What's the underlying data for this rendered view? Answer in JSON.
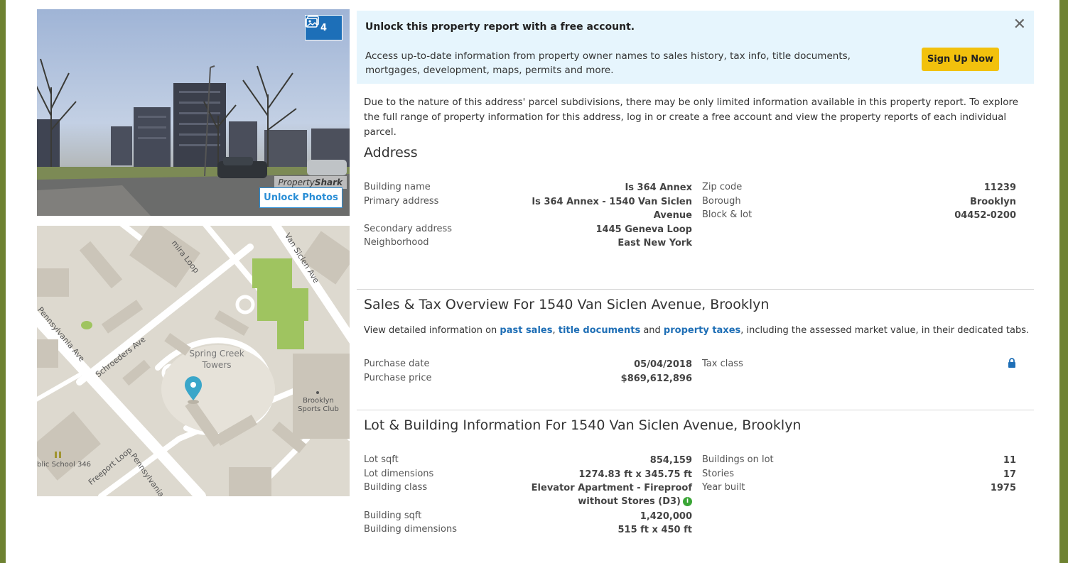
{
  "photo": {
    "count": "4",
    "watermark_a": "Property",
    "watermark_b": "Shark",
    "unlock_label": "Unlock Photos"
  },
  "map": {
    "labels": {
      "elmira_loop": "mira Loop",
      "van_siclen": "Van Siclen Ave",
      "pennsylvania_top": "Pennsylvania Ave",
      "schroeders": "Schroeders Ave",
      "freeport": "Freeport Loop",
      "pennsylvania_bottom": "Pennsylvania A",
      "public_school": "blic School 346"
    },
    "place_line1": "Spring Creek",
    "place_line2": "Towers",
    "club_line1": "Brooklyn",
    "club_line2": "Sports Club"
  },
  "banner": {
    "title": "Unlock this property report with a free account.",
    "text": "Access up-to-date information from property owner names to sales history, tax info, title documents, mortgages, development, maps, permits and more.",
    "signup_label": "Sign Up Now",
    "close_glyph": "✕"
  },
  "notice": "Due to the nature of this address' parcel subdivisions, there may be only limited information available in this property report. To explore the full range of property information for this address, log in or create a free account and view the property reports of each individual parcel.",
  "address": {
    "title": "Address",
    "building_name_label": "Building name",
    "building_name": "Is 364 Annex",
    "primary_address_label": "Primary address",
    "primary_address_line1": "Is 364 Annex - 1540 Van Siclen",
    "primary_address_line2": "Avenue",
    "secondary_address_label": "Secondary address",
    "secondary_address": "1445 Geneva Loop",
    "neighborhood_label": "Neighborhood",
    "neighborhood": "East New York",
    "zip_label": "Zip code",
    "zip": "11239",
    "borough_label": "Borough",
    "borough": "Brooklyn",
    "block_lot_label": "Block & lot",
    "block_lot": "04452-0200"
  },
  "sales": {
    "title": "Sales & Tax Overview For 1540 Van Siclen Avenue, Brooklyn",
    "desc_pre": "View detailed information on ",
    "link_sales": "past sales",
    "sep1": ", ",
    "link_title": "title documents",
    "sep2": " and ",
    "link_taxes": "property taxes",
    "desc_post": ", including the assessed market value, in their dedicated tabs.",
    "purchase_date_label": "Purchase date",
    "purchase_date": "05/04/2018",
    "purchase_price_label": "Purchase price",
    "purchase_price": "$869,612,896",
    "tax_class_label": "Tax class"
  },
  "lot": {
    "title": "Lot & Building Information For 1540 Van Siclen Avenue, Brooklyn",
    "lot_sqft_label": "Lot sqft",
    "lot_sqft": "854,159",
    "lot_dim_label": "Lot dimensions",
    "lot_dim": "1274.83 ft x 345.75 ft",
    "class_label": "Building class",
    "class_line1": "Elevator Apartment - Fireproof",
    "class_line2": "without Stores (D3)",
    "info_glyph": "i",
    "bldg_sqft_label": "Building sqft",
    "bldg_sqft": "1,420,000",
    "bldg_dim_label": "Building dimensions",
    "bldg_dim": "515 ft x 450 ft",
    "buildings_label": "Buildings on lot",
    "buildings": "11",
    "stories_label": "Stories",
    "stories": "17",
    "year_label": "Year built",
    "year": "1975"
  }
}
